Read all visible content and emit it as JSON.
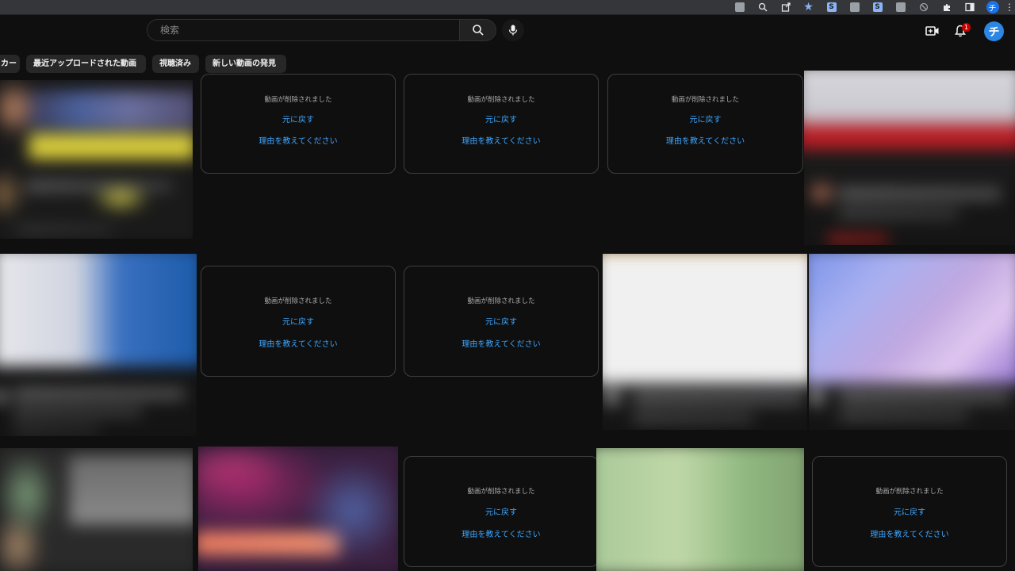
{
  "browser": {
    "extension_icons": [
      "extension-icon",
      "zoom-icon",
      "share-icon",
      "star-icon",
      "s-extension-icon",
      "media-icon",
      "s-extension-icon",
      "extension-icon",
      "blocked-icon",
      "puzzle-icon",
      "sidepanel-icon",
      "profile-icon",
      "menu-icon"
    ],
    "accent": "#8ab4f8"
  },
  "header": {
    "search_placeholder": "検索",
    "search_icon": "search-icon",
    "mic_icon": "mic-icon",
    "create_icon": "create-icon",
    "notifications_icon": "bell-icon",
    "notification_count": "1",
    "avatar_letter": "チ"
  },
  "chips": [
    {
      "label": "カー"
    },
    {
      "label": "最近アップロードされた動画"
    },
    {
      "label": "視聴済み"
    },
    {
      "label": "新しい動画の発見"
    }
  ],
  "removed": {
    "message": "動画が削除されました",
    "undo": "元に戻す",
    "reason": "理由を教えてください"
  },
  "colors": {
    "background": "#0f0f0f",
    "link": "#3ea6ff",
    "badge": "#cc0000"
  }
}
